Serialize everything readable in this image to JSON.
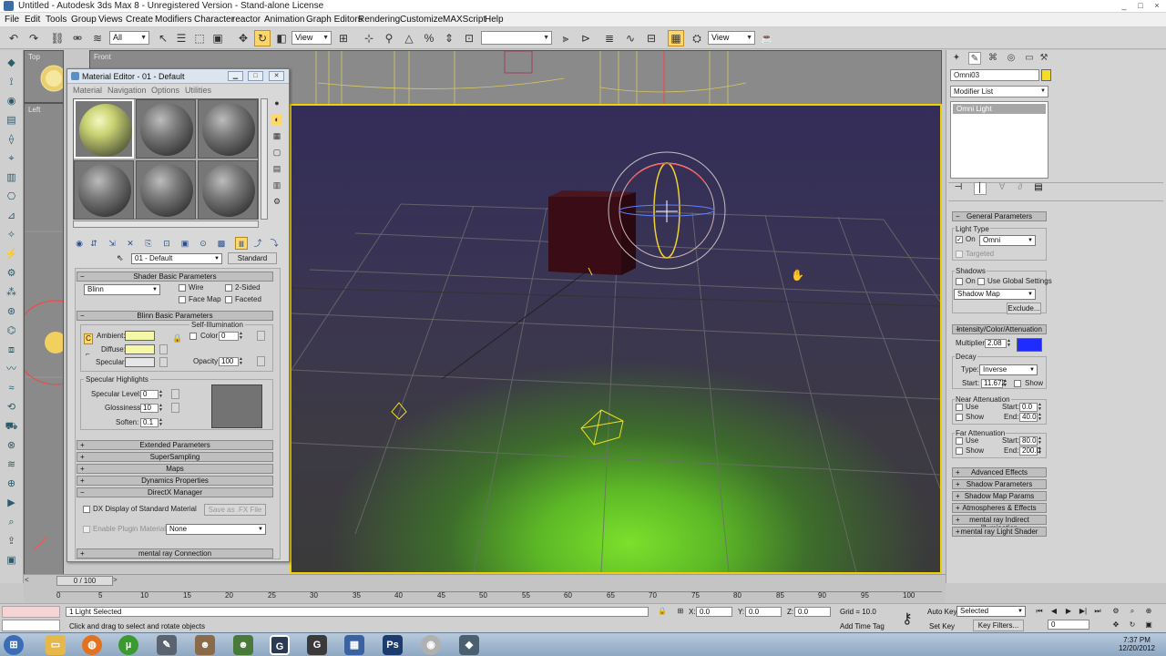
{
  "window": {
    "title": "Untitled - Autodesk 3ds Max 8    - Unregistered Version - Stand-alone License",
    "controls": [
      "_",
      "□",
      "×"
    ]
  },
  "menu": [
    "File",
    "Edit",
    "Tools",
    "Group",
    "Views",
    "Create",
    "Modifiers",
    "Character",
    "reactor",
    "Animation",
    "Graph Editors",
    "Rendering",
    "Customize",
    "MAXScript",
    "Help"
  ],
  "toolbar": {
    "selection_filter": "All",
    "coord_system": "View",
    "named_selection": "",
    "view_dropdown": "View"
  },
  "viewports": {
    "top": "Top",
    "left": "Left",
    "front": "Front"
  },
  "material_editor": {
    "title": "Material Editor - 01 - Default",
    "menu": [
      "Material",
      "Navigation",
      "Options",
      "Utilities"
    ],
    "material_name": "01 - Default",
    "material_type": "Standard",
    "shader_rollout": "Shader Basic Parameters",
    "shader": "Blinn",
    "wire": "Wire",
    "two_sided": "2-Sided",
    "face_map": "Face Map",
    "faceted": "Faceted",
    "blinn_rollout": "Blinn Basic Parameters",
    "self_illum": "Self-Illumination",
    "ambient": "Ambient:",
    "diffuse": "Diffuse:",
    "specular": "Specular:",
    "color_label": "Color",
    "color_value": "0",
    "opacity_label": "Opacity:",
    "opacity_value": "100",
    "spec_highlights": "Specular Highlights",
    "spec_level_label": "Specular Level:",
    "spec_level": "0",
    "glossiness_label": "Glossiness:",
    "glossiness": "10",
    "soften_label": "Soften:",
    "soften": "0.1",
    "rollouts": [
      "Extended Parameters",
      "SuperSampling",
      "Maps",
      "Dynamics Properties",
      "DirectX Manager"
    ],
    "dx_display": "DX Display of Standard Material",
    "save_fx": "Save as .FX File",
    "enable_plugin": "Enable Plugin Material",
    "plugin_value": "None",
    "mental_ray": "mental ray Connection",
    "colors": {
      "ambient": "#f4f8a8",
      "diffuse": "#f4f8a8",
      "specular": "#e6e6e6",
      "preview": "#737373"
    }
  },
  "command_panel": {
    "object_name": "Omni03",
    "object_color": "#f5dc2a",
    "modifier_list": "Modifier List",
    "stack_item": "Omni Light",
    "general_params": "General Parameters",
    "light_type": "Light Type",
    "on": "On",
    "light_kind": "Omni",
    "targeted": "Targeted",
    "shadows": "Shadows",
    "use_global": "Use Global Settings",
    "shadow_type": "Shadow Map",
    "exclude": "Exclude...",
    "intensity_rollout": "Intensity/Color/Attenuation",
    "multiplier_label": "Multiplier:",
    "multiplier": "2.08",
    "light_color": "#1f2cff",
    "decay": "Decay",
    "type_label": "Type:",
    "decay_type": "Inverse",
    "start_label": "Start:",
    "decay_start": "11.672",
    "show": "Show",
    "near_atten": "Near Attenuation",
    "use": "Use",
    "near_start": "0.0",
    "end_label": "End:",
    "near_end": "40.0",
    "far_atten": "Far Attenuation",
    "far_start": "80.0",
    "far_end": "200.0",
    "rollouts": [
      "Advanced Effects",
      "Shadow Parameters",
      "Shadow Map Params",
      "Atmospheres & Effects",
      "mental ray Indirect Illumination",
      "mental ray Light Shader"
    ]
  },
  "timeline": {
    "slider": "0 / 100",
    "ticks": [
      "0",
      "5",
      "10",
      "15",
      "20",
      "25",
      "30",
      "35",
      "40",
      "45",
      "50",
      "55",
      "60",
      "65",
      "70",
      "75",
      "80",
      "85",
      "90",
      "95",
      "100"
    ]
  },
  "status": {
    "selection": "1 Light Selected",
    "prompt": "Click and drag to select and rotate objects",
    "x_label": "X:",
    "x": "0.0",
    "y_label": "Y:",
    "y": "0.0",
    "z_label": "Z:",
    "z": "0.0",
    "grid": "Grid = 10.0",
    "add_time_tag": "Add Time Tag",
    "auto_key": "Auto Key",
    "set_key": "Set Key",
    "key_mode": "Selected",
    "key_filters": "Key Filters...",
    "frame": "0"
  },
  "taskbar": {
    "time": "7:37 PM",
    "date": "12/20/2012",
    "apps": [
      "explorer",
      "firefox",
      "utorrent",
      "app",
      "app",
      "app",
      "app",
      "app",
      "app",
      "photoshop",
      "app",
      "3dsmax"
    ]
  }
}
